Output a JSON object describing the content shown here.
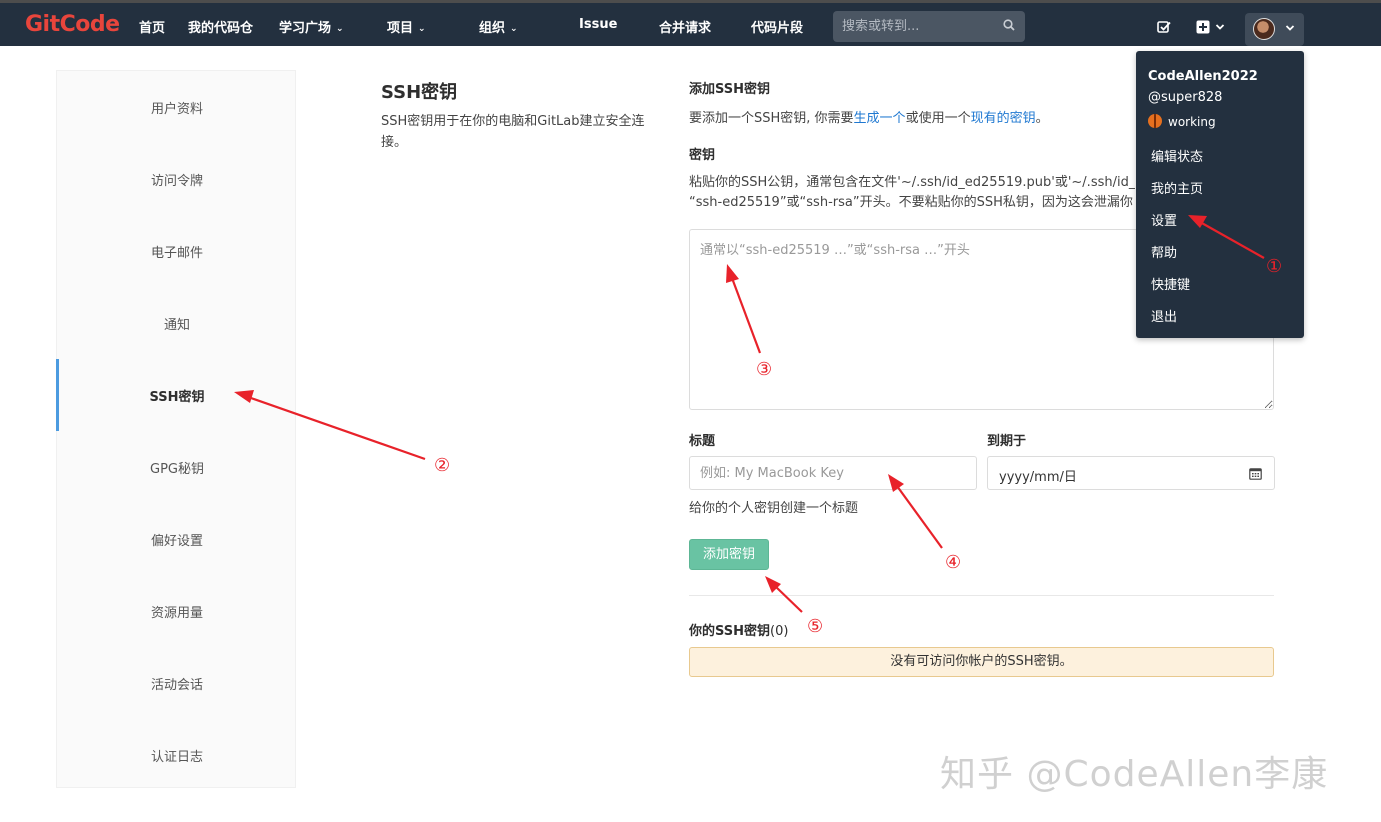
{
  "colors": {
    "nav_bg": "#23303f",
    "brand": "#e8453c",
    "link": "#1f78d1",
    "active_bar": "#4c9be0",
    "primary_button": "#69c3a3",
    "warning_bg": "#fdf1dd",
    "annotation": "#e8222a"
  },
  "topnav": {
    "logo": "GitCode",
    "items": [
      {
        "label": "首页"
      },
      {
        "label": "我的代码仓"
      },
      {
        "label": "学习广场",
        "dropdown": true
      },
      {
        "label": "项目",
        "dropdown": true
      },
      {
        "label": "组织",
        "dropdown": true
      },
      {
        "label": "Issue"
      },
      {
        "label": "合并请求"
      },
      {
        "label": "代码片段"
      }
    ],
    "search_placeholder": "搜索或转到...",
    "icons": [
      "search-icon",
      "todo-icon",
      "plus-square-icon",
      "chevron-down-icon",
      "avatar"
    ]
  },
  "user_menu": {
    "name": "CodeAllen2022",
    "handle": "@super828",
    "status": "working",
    "status_icon": "basketball-icon",
    "items": [
      "编辑状态",
      "我的主页",
      "设置",
      "帮助",
      "快捷键",
      "退出"
    ]
  },
  "sidebar": {
    "items": [
      {
        "label": "用户资料"
      },
      {
        "label": "访问令牌"
      },
      {
        "label": "电子邮件"
      },
      {
        "label": "通知"
      },
      {
        "label": "SSH密钥",
        "active": true
      },
      {
        "label": "GPG秘钥"
      },
      {
        "label": "偏好设置"
      },
      {
        "label": "资源用量"
      },
      {
        "label": "活动会话"
      },
      {
        "label": "认证日志"
      }
    ]
  },
  "section": {
    "title": "SSH密钥",
    "description": "SSH密钥用于在你的电脑和GitLab建立安全连接。"
  },
  "form": {
    "add_heading": "添加SSH密钥",
    "intro_prefix": "要添加一个SSH密钥, 你需要",
    "intro_link1": "生成一个",
    "intro_middle": "或使用一个",
    "intro_link2": "现有的密钥",
    "intro_suffix": "。",
    "key_label": "密钥",
    "key_help_line1": "粘贴你的SSH公钥，通常包含在文件'~/.ssh/id_ed25519.pub'或'~/.ssh/id_",
    "key_help_line2": "“ssh-ed25519”或“ssh-rsa”开头。不要粘贴你的SSH私钥，因为这会泄漏你",
    "key_placeholder": "通常以“ssh-ed25519 …”或“ssh-rsa …”开头",
    "title_label": "标题",
    "title_placeholder": "例如: My MacBook Key",
    "title_help": "给你的个人密钥创建一个标题",
    "expires_label": "到期于",
    "expires_value": "yyyy/mm/日",
    "submit_label": "添加密钥"
  },
  "keys_list": {
    "heading": "你的SSH密钥",
    "count": "(0)",
    "empty_message": "没有可访问你帐户的SSH密钥。"
  },
  "annotations": {
    "markers": [
      "①",
      "②",
      "③",
      "④",
      "⑤"
    ],
    "watermark": "知乎 @CodeAllen李康"
  }
}
